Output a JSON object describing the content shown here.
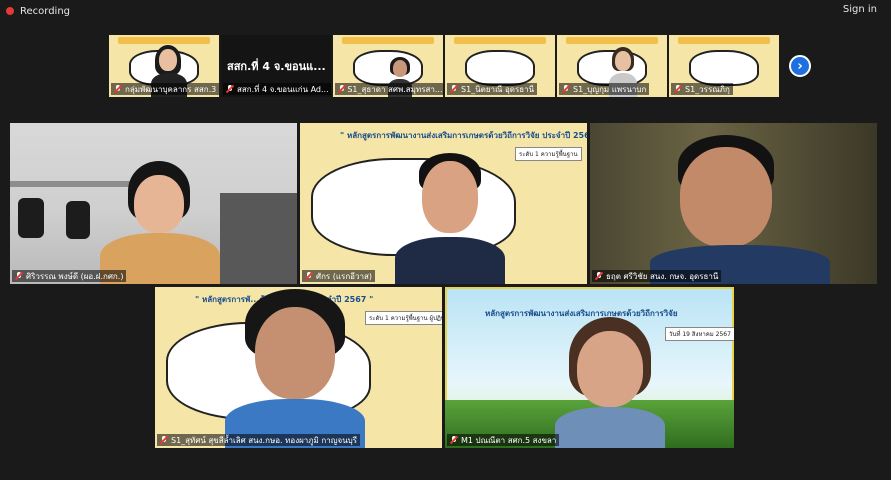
{
  "topbar": {
    "recording_label": "Recording",
    "signin_label": "Sign in"
  },
  "colors": {
    "accent": "#1e6fe0",
    "recording": "#e53935",
    "active_speaker": "#e8d34a"
  },
  "strip": {
    "tiles": [
      {
        "name": "กลุ่มพัฒนาบุคลากร สสก.3",
        "muted": true
      },
      {
        "title": "สสก.ที่ 4 จ.ขอนแ...",
        "name": "สสก.ที่ 4 จ.ขอนแก่น Ad...",
        "muted": true
      },
      {
        "name": "S1_สุธาดา สศพ.สมุทรสา...",
        "muted": true
      },
      {
        "name": "S1_นิตยาณี อุดรธานี",
        "muted": true
      },
      {
        "name": "S1_บุญกุม แพรนาบก",
        "muted": true
      },
      {
        "name": "S1_วรรณภิกุ",
        "muted": true
      }
    ],
    "next_icon": "chevron-right-icon"
  },
  "grid": {
    "tiles": [
      {
        "name": "ศิริวรรณ พงษ์ดี (ผอ.ฝ.กศก.)",
        "muted": true
      },
      {
        "name": "ศักร (แรกอีวาส)",
        "muted": true,
        "slide_title": "\" หลักสูตรการพัฒนางานส่งเสริมการเกษตรด้วยวิถีการวิจัย ประจำปี 2567 \"",
        "slide_badge": "ระดับ 1 ความรู้พื้นฐาน"
      },
      {
        "name": "ธฤต ศรีวิชัย สนง. กษจ. อุดรธานี",
        "muted": true
      },
      {
        "name": "S1_สุทัศน์ สุขสีล้ำเลิศ สนง.กษอ. ทองผาภูมิ กาญจนบุรี",
        "muted": true,
        "slide_title": "\" หลักสูตรการพั...ด้วยวิถีการวิจัย ประจำปี 2567 \"",
        "slide_badge": "ระดับ 1 ความรู้พื้นฐาน ผู้ปฏิบัติ"
      },
      {
        "name": "M1 ปณณีตา สศก.5 สงขลา",
        "muted": true,
        "slide_title": "หลักสูตรการพัฒนางานส่งเสริมการเกษตรด้วยวิถีการวิจัย",
        "slide_badge": "วันที่ 19 สิงหาคม 2567"
      }
    ]
  }
}
